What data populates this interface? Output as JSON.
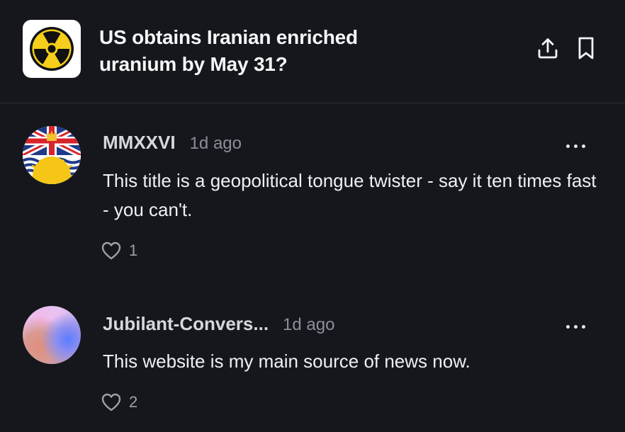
{
  "market": {
    "title": "US obtains Iranian enriched uranium by May 31?",
    "thumbnail_icon": "radiation-icon",
    "actions": {
      "share_icon": "share-upload-icon",
      "bookmark_icon": "bookmark-icon"
    }
  },
  "comments": [
    {
      "username": "MMXXVI",
      "timestamp": "1d ago",
      "text": "This title is a geopolitical tongue twister - say it ten times fast - you can't.",
      "likes": "1",
      "avatar": "british-columbia-flag-avatar",
      "more_icon": "more-options-icon"
    },
    {
      "username": "Jubilant-Convers...",
      "timestamp": "1d ago",
      "text": "This website is my main source of news now.",
      "likes": "2",
      "avatar": "gradient-avatar",
      "more_icon": "more-options-icon"
    }
  ],
  "colors": {
    "background": "#15171c",
    "divider": "#2b2e35",
    "text_primary": "#eef0f3",
    "text_muted": "#8a8f99",
    "radiation_yellow": "#f5cf1b"
  }
}
